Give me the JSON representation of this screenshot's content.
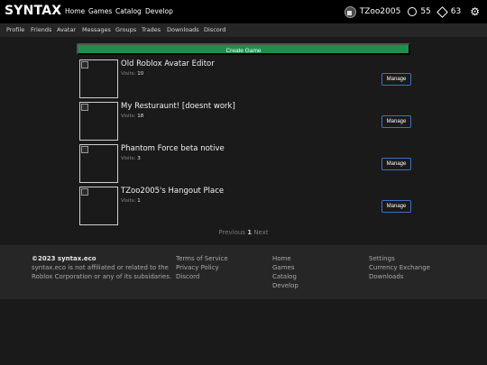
{
  "brand": "SYNTAX",
  "topnav": [
    "Home",
    "Games",
    "Catalog",
    "Develop"
  ],
  "user": {
    "name": "TZoo2005",
    "robux": "55",
    "tickets": "63"
  },
  "subnav": [
    "Profile",
    "Friends",
    "Avatar",
    "Messages",
    "Groups",
    "Trades",
    "Downloads",
    "Discord"
  ],
  "create_label": "Create Game",
  "visits_label": "Visits:",
  "manage_label": "Manage",
  "games": [
    {
      "name": "Old Roblox Avatar Editor",
      "visits": "10"
    },
    {
      "name": "My Resturaunt! [doesnt work]",
      "visits": "18"
    },
    {
      "name": "Phantom Force beta notive",
      "visits": "3"
    },
    {
      "name": "TZoo2005's Hangout Place",
      "visits": "1"
    }
  ],
  "pager": {
    "prev": "Previous",
    "page": "1",
    "next": "Next"
  },
  "footer": {
    "copyright": "©2023 syntax.eco",
    "disclaimer": [
      "syntax.eco is not affiliated or related to the",
      "Roblox Corporation or any of its subsidaries."
    ],
    "legal": [
      "Terms of Service",
      "Privacy Policy",
      "Discord"
    ],
    "nav": [
      "Home",
      "Games",
      "Catalog",
      "Develop"
    ],
    "misc": [
      "Settings",
      "Currency Exchange",
      "Downloads"
    ]
  }
}
